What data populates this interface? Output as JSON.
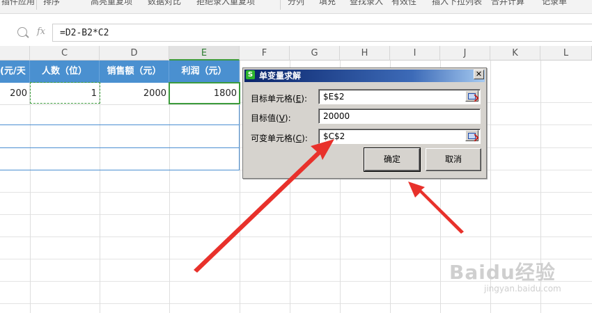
{
  "ribbon": {
    "items": [
      "插件应用",
      "排序",
      "高亮重复项",
      "数据对比",
      "拒绝录入重复项",
      "分列",
      "填充",
      "查找录入",
      "有效性",
      "插入下拉列表",
      "合并计算",
      "记录单"
    ]
  },
  "formula_bar": {
    "fx_label": "fx",
    "formula": "=D2-B2*C2"
  },
  "columns": [
    "C",
    "D",
    "E",
    "F",
    "G",
    "H",
    "I",
    "J",
    "K",
    "L"
  ],
  "active_column": "E",
  "table": {
    "headers": [
      "元/天)",
      "人数（位）",
      "销售额（元）",
      "利润（元）"
    ],
    "row2": [
      "200",
      "1",
      "2000",
      "1800"
    ]
  },
  "dialog": {
    "title": "单变量求解",
    "logo": "S",
    "close": "✕",
    "target_cell_label": "目标单元格(",
    "target_cell_key": "E",
    "target_cell_value": "$E$2",
    "target_value_label": "目标值(",
    "target_value_key": "V",
    "target_value_value": "20000",
    "changing_cell_label": "可变单元格(",
    "changing_cell_key": "C",
    "changing_cell_value": "$C$2",
    "ok_label": "确定",
    "cancel_label": "取消"
  },
  "watermark": {
    "logo_text": "Baidu经验",
    "url": "jingyan.baidu.com"
  },
  "colors": {
    "header_blue": "#4a90d0",
    "selection_green": "#3c9b3c",
    "arrow_red": "#e8312b",
    "dialog_title_start": "#0a246a"
  }
}
